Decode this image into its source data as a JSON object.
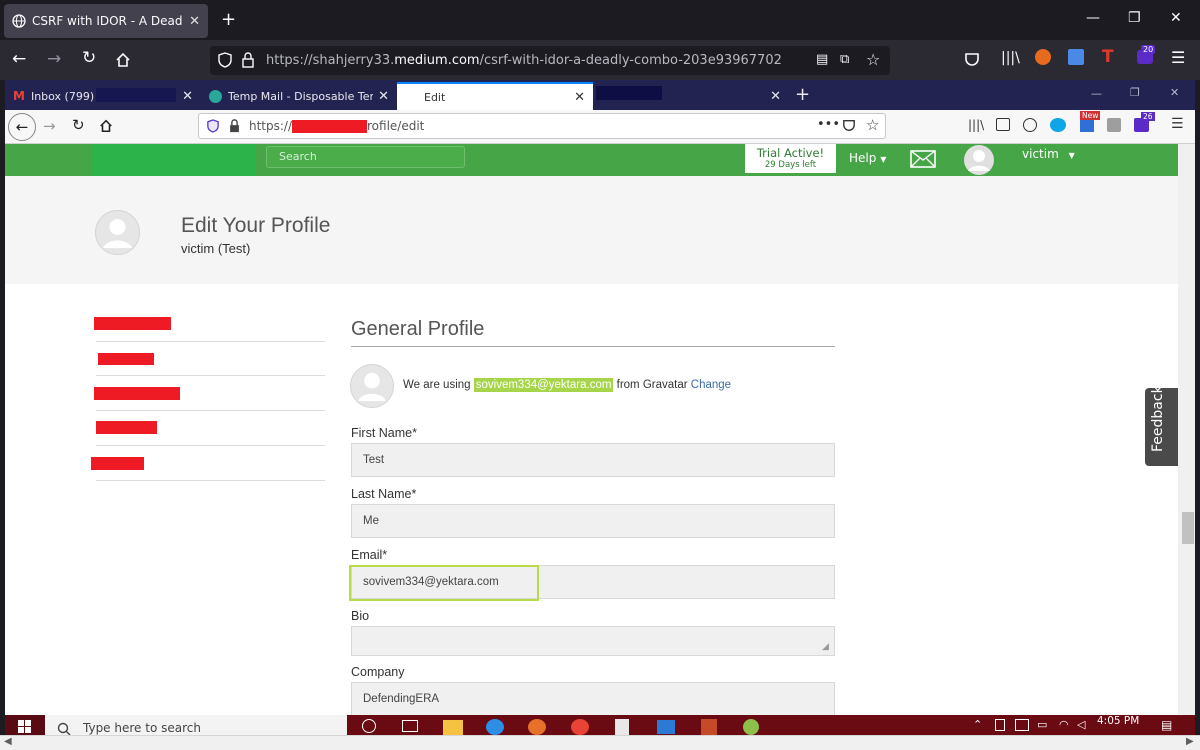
{
  "outer_browser": {
    "tab_title": "CSRF with IDOR - A Deadly Com",
    "url_prefix": "https://shahjerry33.",
    "url_domain": "medium.com",
    "url_suffix": "/csrf-with-idor-a-deadly-combo-203e93967702",
    "badge_count": "20"
  },
  "inner_browser": {
    "tabs": [
      {
        "label": "Inbox (799) -"
      },
      {
        "label": "Temp Mail - Disposable Tempo"
      },
      {
        "label": "Edit"
      }
    ],
    "url_prefix": "https://",
    "url_suffix": "rofile/edit",
    "new_badge": "New",
    "ext_count": "26"
  },
  "site": {
    "search_placeholder": "Search",
    "trial_title": "Trial Active!",
    "trial_days": "29 Days left",
    "help_label": "Help",
    "username": "victim"
  },
  "banner": {
    "title": "Edit Your Profile",
    "subtitle": "victim (Test)"
  },
  "form": {
    "title": "General Profile",
    "gravatar_prefix": "We are using",
    "gravatar_email": "sovivem334@yektara.com",
    "gravatar_suffix": "from Gravatar",
    "gravatar_change": "Change",
    "first_name_label": "First Name*",
    "first_name_value": "Test",
    "last_name_label": "Last Name*",
    "last_name_value": "Me",
    "email_label": "Email*",
    "email_value": "sovivem334@yektara.com",
    "bio_label": "Bio",
    "bio_value": "",
    "company_label": "Company",
    "company_value": "DefendingERA"
  },
  "feedback_label": "Feedback",
  "taskbar": {
    "search_placeholder": "Type here to search",
    "time": "4:05 PM"
  },
  "colors": {
    "site_green": "#46a546",
    "highlight_green": "#a6d54a",
    "redaction_red": "#ee1b24"
  }
}
